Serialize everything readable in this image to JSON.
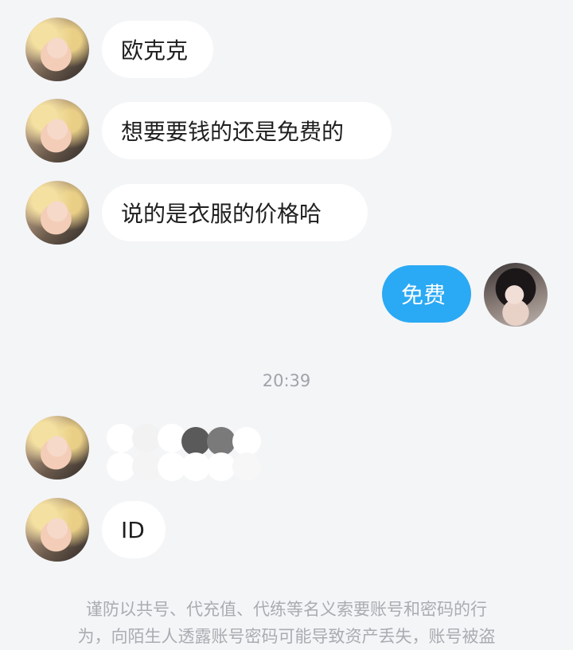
{
  "messages": [
    {
      "side": "them",
      "text": "欧克克"
    },
    {
      "side": "them",
      "text": "想要要钱的还是免费的"
    },
    {
      "side": "them",
      "text": "说的是衣服的价格哈"
    },
    {
      "side": "me",
      "text": "免费"
    },
    {
      "side": "them",
      "type": "sticker",
      "text": ""
    },
    {
      "side": "them",
      "text": "ID"
    }
  ],
  "timestamp": "20:39",
  "warning_line1": "谨防以共号、代充值、代练等名义索要账号和密码的行",
  "warning_line2": "为，向陌生人透露账号密码可能导致资产丢失，账号被盗",
  "colors": {
    "background": "#f4f5f7",
    "incoming_bubble": "#ffffff",
    "outgoing_bubble": "#2aa9f4",
    "timestamp": "#a0a3a8",
    "warning_text": "#a9acb0"
  }
}
